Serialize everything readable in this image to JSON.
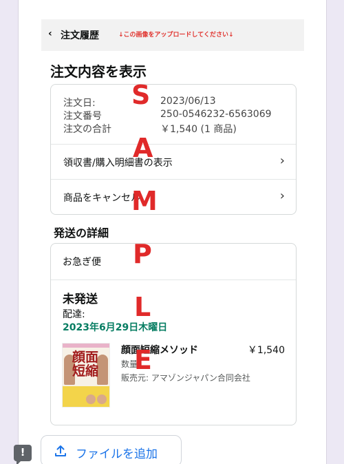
{
  "header": {
    "back_glyph": "‹",
    "title": "注文履歴",
    "note": "↓この画像をアップロードしてください↓"
  },
  "page_title": "注文内容を表示",
  "order_info": {
    "rows": [
      {
        "label": "注文日:",
        "value": "2023/06/13"
      },
      {
        "label": "注文番号",
        "value": "250-0546232-6563069"
      },
      {
        "label": "注文の合計",
        "value": "￥1,540 (1 商品)"
      }
    ]
  },
  "links": {
    "receipt": "領収書/購入明細書の表示",
    "cancel": "商品をキャンセル"
  },
  "shipping": {
    "section_title": "発送の詳細",
    "method": "お急ぎ便",
    "status": "未発送",
    "delivery_label": "配達:",
    "delivery_date": "2023年6月29日木曜日"
  },
  "product": {
    "name": "顔面短縮メソッド",
    "price": "￥1,540",
    "qty_label": "数量",
    "seller": "販売元: アマゾンジャパン合同会社",
    "cover_title": "顔面短縮"
  },
  "upload": {
    "label": "ファイルを追加"
  },
  "feedback_glyph": "!",
  "watermark": [
    "S",
    "A",
    "M",
    "P",
    "L",
    "E"
  ],
  "colors": {
    "delivery_green": "#067d62",
    "note_red": "#e0322d",
    "watermark_red": "#e02a2a",
    "link_blue": "#1a73e8"
  }
}
